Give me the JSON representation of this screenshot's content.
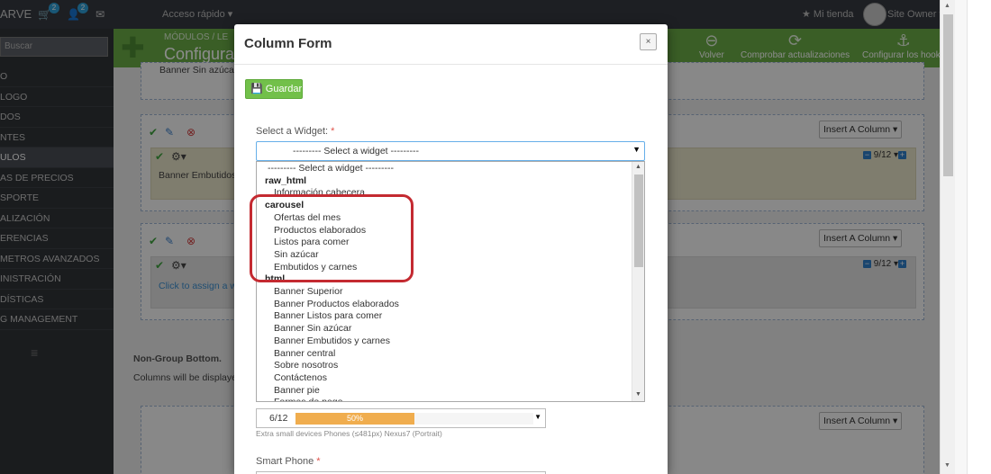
{
  "topbar": {
    "brand": "ARVE",
    "cart_badge": "2",
    "users_badge": "2",
    "quick_access": "Acceso rápido ▾",
    "my_store": "★ Mi tienda",
    "owner": "Site Owner ▾"
  },
  "sidebar": {
    "search_placeholder": "Buscar",
    "items": [
      {
        "label": "O"
      },
      {
        "label": "LOGO"
      },
      {
        "label": "DOS"
      },
      {
        "label": "NTES"
      },
      {
        "label": "ULOS"
      },
      {
        "label": "AS DE PRECIOS"
      },
      {
        "label": "SPORTE"
      },
      {
        "label": "ALIZACIÓN"
      },
      {
        "label": "ERENCIAS"
      },
      {
        "label": "METROS AVANZADOS"
      },
      {
        "label": "INISTRACIÓN"
      },
      {
        "label": "DÍSTICAS"
      },
      {
        "label": "G MANAGEMENT"
      }
    ],
    "collapse": "≡"
  },
  "toolbar": {
    "breadcrumb": "MÓDULOS  /  LE",
    "title": "Configurar",
    "back": "Volver",
    "check_updates": "Comprobar actualizaciones",
    "hooks": "Configurar los hooks"
  },
  "content": {
    "banner_top_text": "Banner Sin azúcar",
    "insert_column": "Insert A Column ▾",
    "size_label": "9/12 ▾",
    "banner_embutidos": "Banner Embutidos",
    "click_assign": "Click to assign a w",
    "non_group_bottom": "Non-Group Bottom.",
    "columns_will_be": "Columns will be displaye"
  },
  "modal": {
    "title": "Column Form",
    "close": "×",
    "save_label": "Guardar",
    "widget_label": "Select a Widget:",
    "required": "*",
    "select_value": "--------- Select a widget ---------",
    "listbox": [
      {
        "type": "option",
        "label": "--------- Select a widget ---------"
      },
      {
        "type": "group",
        "label": "raw_html"
      },
      {
        "type": "option",
        "label": "Información cabecera"
      },
      {
        "type": "group",
        "label": "carousel"
      },
      {
        "type": "option",
        "label": "Ofertas del mes"
      },
      {
        "type": "option",
        "label": "Productos elaborados"
      },
      {
        "type": "option",
        "label": "Listos para comer"
      },
      {
        "type": "option",
        "label": "Sin azúcar"
      },
      {
        "type": "option",
        "label": "Embutidos y carnes"
      },
      {
        "type": "group",
        "label": "html"
      },
      {
        "type": "option",
        "label": "Banner Superior"
      },
      {
        "type": "option",
        "label": "Banner Productos elaborados"
      },
      {
        "type": "option",
        "label": "Banner Listos para comer"
      },
      {
        "type": "option",
        "label": "Banner Sin azúcar"
      },
      {
        "type": "option",
        "label": "Banner Embutidos y carnes"
      },
      {
        "type": "option",
        "label": "Banner central"
      },
      {
        "type": "option",
        "label": "Sobre nosotros"
      },
      {
        "type": "option",
        "label": "Contáctenos"
      },
      {
        "type": "option",
        "label": "Banner pie"
      },
      {
        "type": "option",
        "label": "Formas de pago"
      }
    ],
    "column_size": "6/12",
    "progress_label": "50%",
    "progress_value": 0.5,
    "size_hint": "Extra small devices Phones (≤481px) Nexus7 (Portrait)",
    "smartphone_label": "Smart Phone"
  },
  "colors": {
    "accent_green": "#6aac46",
    "save_green": "#72c04a",
    "progress_orange": "#f0ad4e",
    "highlight_red": "#c42a31",
    "sidebar_dark": "#303338"
  }
}
